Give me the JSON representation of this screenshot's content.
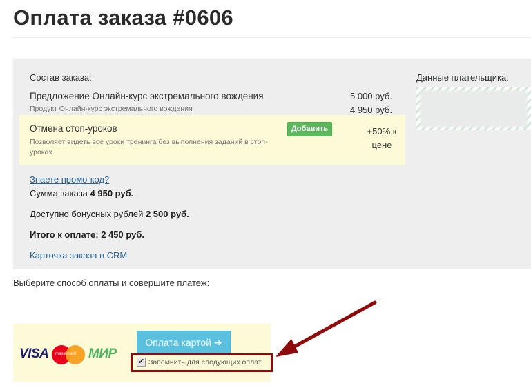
{
  "page": {
    "title": "Оплата заказа #0606"
  },
  "order": {
    "composition_label": "Состав заказа:",
    "offer": {
      "title": "Предложение Онлайн-курс экстремального вождения",
      "subtitle": "Продукт Онлайн-курс экстремального вождения",
      "price_old": "5 000 руб.",
      "price_new": "4 950 руб."
    },
    "upsell": {
      "title": "Отмена стоп-уроков",
      "description": "Позволяет видеть все уроки тренинга без выполнения заданий в стоп-уроках",
      "add_label": "Добавить",
      "discount_line1": "+50% к",
      "discount_line2": "цене"
    },
    "promo_link": "Знаете промо-код?",
    "sum_label": "Сумма заказа ",
    "sum_value": "4 950 руб.",
    "bonus_label": "Доступно бонусных рублей ",
    "bonus_value": "2 500 руб.",
    "total": "Итого к оплате: 2 450 руб.",
    "crm_link": "Карточка заказа в CRM"
  },
  "payer": {
    "label": "Данные плательщика:"
  },
  "payment": {
    "prompt": "Выберите способ оплаты и совершите платеж:",
    "logos": {
      "visa": "VISA",
      "mastercard": "mastercard",
      "mir": "МИР"
    },
    "pay_button_label": "Оплата картой ➔",
    "remember_label": "Запомнить для следующих оплат",
    "remember_checked": true
  },
  "colors": {
    "panel_bg": "#eeeeee",
    "highlight_bg": "#fdfad8",
    "add_button": "#5cb85c",
    "pay_button": "#5bc0de",
    "link": "#2a6496",
    "annotation": "#8f0a0a"
  }
}
